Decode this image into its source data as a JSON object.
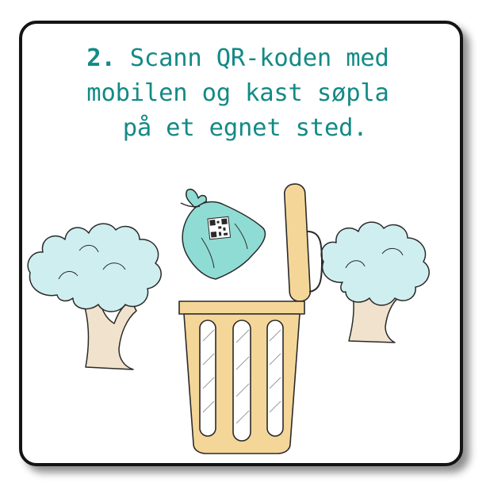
{
  "caption": {
    "step_number": "2.",
    "line1_rest": " Scann QR-koden med",
    "line2": "mobilen og kast søpla",
    "line3": " på et egnet sted."
  },
  "colors": {
    "caption_text": "#138a86",
    "bin_fill": "#f5d699",
    "bag_fill": "#8fdcd4",
    "foliage_fill": "#cfeef0",
    "trunk_fill": "#f0e2cc",
    "card_border": "#141414"
  },
  "icons": [
    "tree-icon",
    "trash-bag-icon",
    "qr-code-icon",
    "trash-bin-icon",
    "tree-icon"
  ]
}
